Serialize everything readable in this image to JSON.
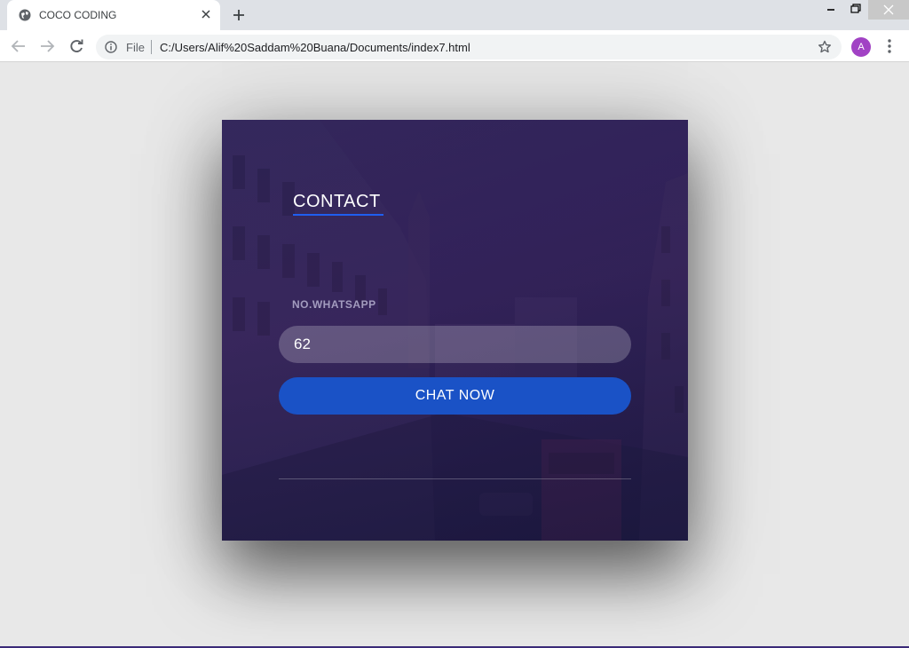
{
  "browser": {
    "tab": {
      "title": "COCO CODING",
      "favicon": "globe-icon"
    },
    "address_bar": {
      "scheme_label": "File",
      "url": "C:/Users/Alif%20Saddam%20Buana/Documents/index7.html"
    },
    "profile": {
      "initial": "A",
      "color": "#a142c4"
    }
  },
  "page": {
    "heading": "CONTACT",
    "field_label": "NO.WHATSAPP",
    "phone_value": "62",
    "button_label": "CHAT NOW",
    "colors": {
      "accent": "#1f5ef0",
      "button": "#1a52c6",
      "card_tint": "#32245a"
    }
  }
}
